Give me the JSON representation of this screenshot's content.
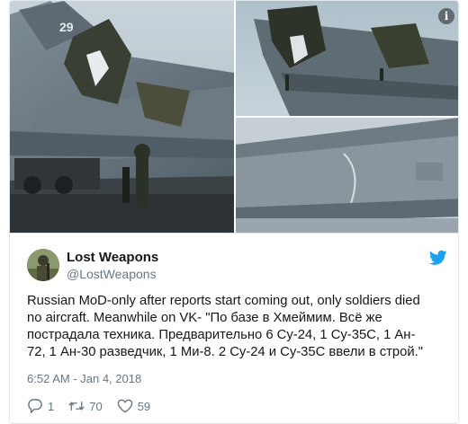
{
  "media": {
    "photos": [
      {
        "icon": "damaged-jet-rear-photo",
        "tail_number": "29"
      },
      {
        "icon": "damaged-wing-closeup-photo"
      },
      {
        "icon": "wing-underside-photo"
      }
    ],
    "info_icon": "i"
  },
  "tweet": {
    "author_name": "Lost Weapons",
    "author_handle": "@LostWeapons",
    "body_lines": [
      "Russian MoD-only after reports start coming out, only soldiers died",
      "no aircraft. Meanwhile on VK- \"По базе в Хмеймим. Всё же",
      "пострадала техника. Предварительно 6 Су-24, 1 Су-35С, 1 Ан-",
      "72, 1 Ан-30 разведчик, 1 Ми-8. 2 Су-24 и Су-35С ввели в строй.\""
    ],
    "timestamp": "6:52 AM - Jan 4, 2018",
    "reply_count": "1",
    "retweet_count": "70",
    "like_count": "59"
  },
  "colors": {
    "twitter_blue": "#1da1f2",
    "secondary_text": "#657786",
    "primary_text": "#14171a"
  }
}
